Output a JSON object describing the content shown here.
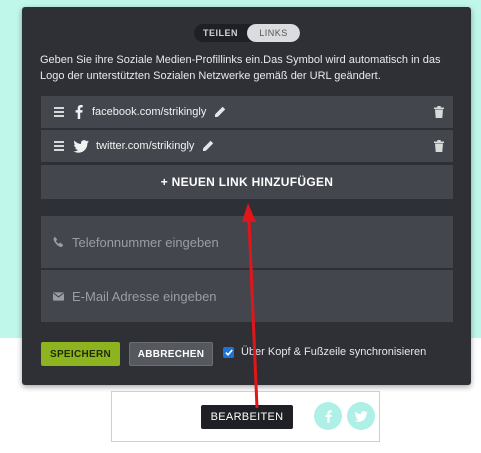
{
  "toggle": {
    "tab_share": "TEILEN",
    "tab_links": "LINKS",
    "active": "tab_links"
  },
  "description": "Geben Sie ihre Soziale Medien-Profillinks ein.Das Symbol wird automatisch in das Logo der unterstützten Sozialen Netzwerke gemäß der URL geändert.",
  "links": [
    {
      "icon": "facebook-icon",
      "url": "facebook.com/strikingly"
    },
    {
      "icon": "twitter-icon",
      "url": "twitter.com/strikingly"
    }
  ],
  "add_link_label": "+ NEUEN LINK HINZUFÜGEN",
  "phone": {
    "icon": "phone-icon",
    "placeholder": "Telefonnummer eingeben"
  },
  "email": {
    "icon": "envelope-icon",
    "placeholder": "E-Mail Adresse eingeben"
  },
  "actions": {
    "save_label": "SPEICHERN",
    "cancel_label": "ABBRECHEN",
    "sync_label": "Über Kopf & Fußzeile synchronisieren",
    "sync_checked": true
  },
  "preview": {
    "edit_label": "BEARBEITEN",
    "icons": [
      "facebook-icon",
      "twitter-icon"
    ]
  },
  "colors": {
    "background": "#bff7ea",
    "panel": "#2f3036",
    "row": "#44464e",
    "save_button": "#8db41f",
    "checkbox": "#1c73d8",
    "annotation_arrow": "#e0161b",
    "social_circle": "#aef0e6"
  }
}
